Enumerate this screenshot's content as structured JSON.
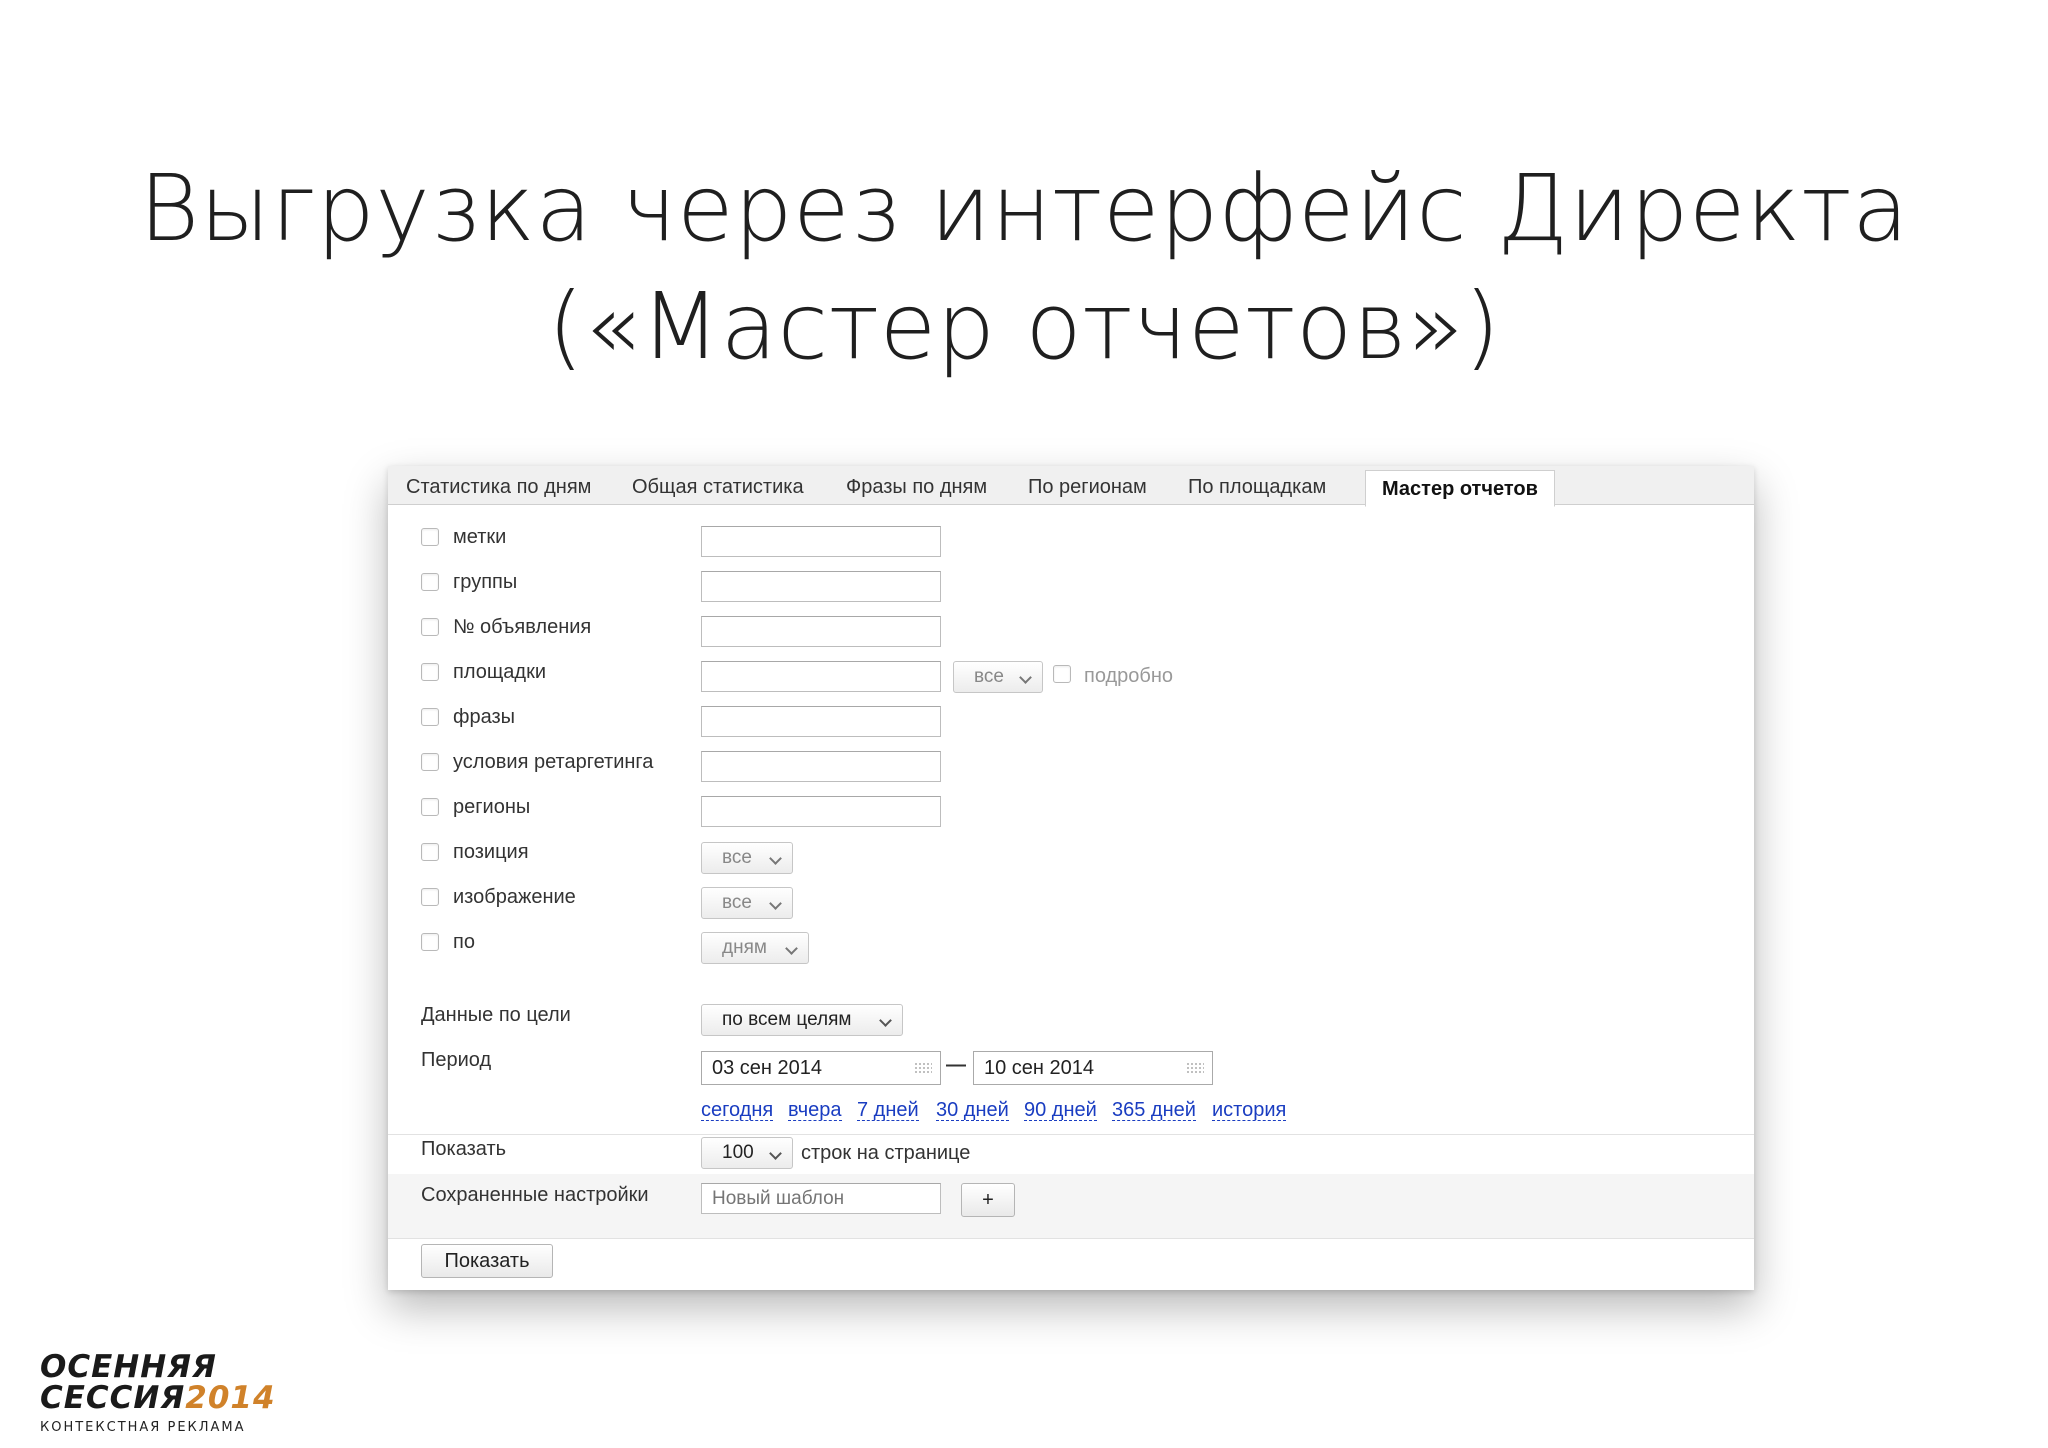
{
  "slide": {
    "title_line1": "Выгрузка через интерфейс Директа",
    "title_line2": "(«Мастер отчетов»)"
  },
  "tabs": [
    {
      "label": "Статистика по дням",
      "active": false
    },
    {
      "label": "Общая статистика",
      "active": false
    },
    {
      "label": "Фразы по дням",
      "active": false
    },
    {
      "label": "По регионам",
      "active": false
    },
    {
      "label": "По площадкам",
      "active": false
    },
    {
      "label": "Мастер отчетов",
      "active": true
    }
  ],
  "filters": [
    {
      "label": "метки",
      "checked": false
    },
    {
      "label": "группы",
      "checked": false
    },
    {
      "label": "№ объявления",
      "checked": false
    },
    {
      "label": "площадки",
      "checked": false
    },
    {
      "label": "фразы",
      "checked": false
    },
    {
      "label": "условия ретаргетинга",
      "checked": false
    },
    {
      "label": "регионы",
      "checked": false
    },
    {
      "label": "позиция",
      "checked": false
    },
    {
      "label": "изображение",
      "checked": false
    },
    {
      "label": "по",
      "checked": false
    }
  ],
  "placements": {
    "select_value": "все",
    "detail_label": "подробно"
  },
  "position_select": "все",
  "image_select": "все",
  "group_by_select": "дням",
  "goal": {
    "label": "Данные по цели",
    "select_value": "по всем целям"
  },
  "period": {
    "label": "Период",
    "from": "03 сен 2014",
    "to": "10 сен 2014",
    "separator": "—",
    "quick_links": [
      "сегодня",
      "вчера",
      "7 дней",
      "30 дней",
      "90 дней",
      "365 дней",
      "история"
    ]
  },
  "show": {
    "label": "Показать",
    "rows_value": "100",
    "rows_suffix": "строк на странице"
  },
  "saved": {
    "label": "Сохраненные настройки",
    "placeholder": "Новый шаблон",
    "add_label": "+"
  },
  "submit_label": "Показать",
  "logo": {
    "line1": "ОСЕННЯЯ",
    "line2_a": "СЕССИЯ",
    "line2_b": "2014",
    "subtitle": "КОНТЕКСТНАЯ РЕКЛАМА"
  },
  "colors": {
    "link": "#1a3dc1",
    "logo_accent": "#d0822a"
  }
}
